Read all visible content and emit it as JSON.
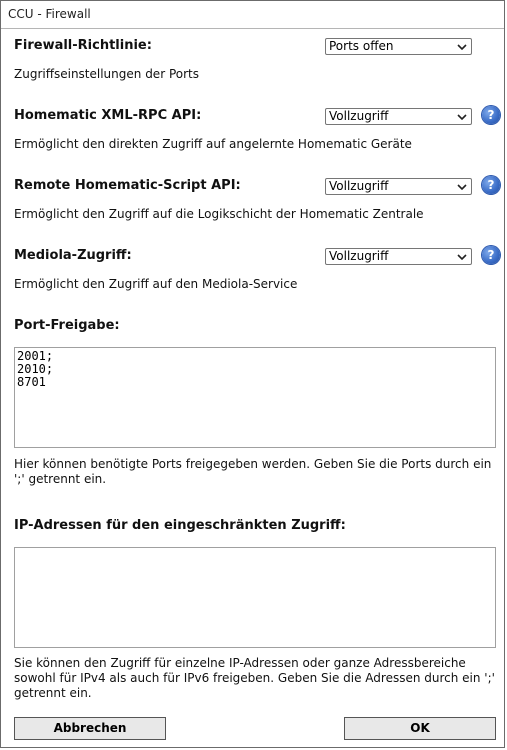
{
  "window": {
    "title": "CCU - Firewall",
    "close_glyph": "×"
  },
  "sections": {
    "firewall_policy": {
      "label": "Firewall-Richtlinie:",
      "value": "Ports offen",
      "description": "Zugriffseinstellungen der Ports"
    },
    "xmlrpc_api": {
      "label": "Homematic XML-RPC API:",
      "value": "Vollzugriff",
      "description": "Ermöglicht den direkten Zugriff auf angelernte Homematic Geräte"
    },
    "script_api": {
      "label": "Remote Homematic-Script API:",
      "value": "Vollzugriff",
      "description": "Ermöglicht den Zugriff auf die Logikschicht der Homematic Zentrale"
    },
    "mediola": {
      "label": "Mediola-Zugriff:",
      "value": "Vollzugriff",
      "description": "Ermöglicht den Zugriff auf den Mediola-Service"
    },
    "port_release": {
      "label": "Port-Freigabe:",
      "value": "2001;\n2010;\n8701",
      "description": "Hier können benötigte Ports freigegeben werden. Geben Sie die Ports durch ein ';' getrennt ein."
    },
    "ip_restricted": {
      "label": "IP-Adressen für den eingeschränkten Zugriff:",
      "value": "",
      "description": "Sie können den Zugriff für einzelne IP-Adressen oder ganze Adressbereiche sowohl für IPv4 als auch für IPv6 freigeben. Geben Sie die Adressen durch ein ';' getrennt ein."
    }
  },
  "help_glyph": "?",
  "icons": {
    "help": "help-icon",
    "dropdown": "chevron-down-icon",
    "close": "close-icon"
  },
  "colors": {
    "help_blue": "#3d6fc9"
  },
  "buttons": {
    "cancel": "Abbrechen",
    "ok": "OK"
  }
}
